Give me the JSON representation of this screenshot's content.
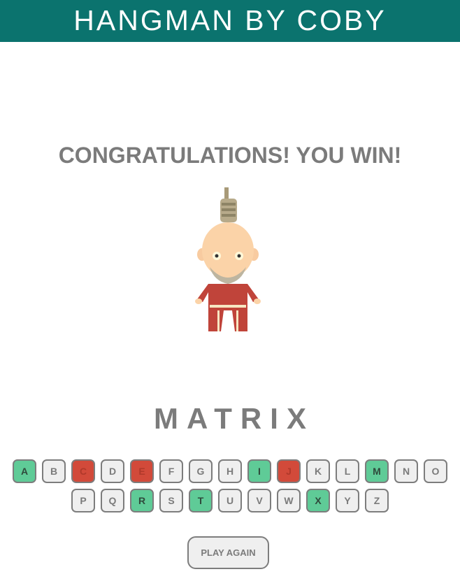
{
  "header": {
    "title": "HANGMAN BY COBY"
  },
  "game": {
    "status_message": "CONGRATULATIONS! YOU WIN!",
    "word_letters": [
      "M",
      "A",
      "T",
      "R",
      "I",
      "X"
    ],
    "wrong_guesses": 3
  },
  "keyboard": {
    "rows": [
      [
        {
          "letter": "A",
          "state": "correct"
        },
        {
          "letter": "B",
          "state": "unused"
        },
        {
          "letter": "C",
          "state": "wrong"
        },
        {
          "letter": "D",
          "state": "unused"
        },
        {
          "letter": "E",
          "state": "wrong"
        },
        {
          "letter": "F",
          "state": "unused"
        },
        {
          "letter": "G",
          "state": "unused"
        },
        {
          "letter": "H",
          "state": "unused"
        },
        {
          "letter": "I",
          "state": "correct"
        },
        {
          "letter": "J",
          "state": "wrong"
        },
        {
          "letter": "K",
          "state": "unused"
        },
        {
          "letter": "L",
          "state": "unused"
        },
        {
          "letter": "M",
          "state": "correct"
        },
        {
          "letter": "N",
          "state": "unused"
        },
        {
          "letter": "O",
          "state": "unused"
        }
      ],
      [
        {
          "letter": "P",
          "state": "unused"
        },
        {
          "letter": "Q",
          "state": "unused"
        },
        {
          "letter": "R",
          "state": "correct"
        },
        {
          "letter": "S",
          "state": "unused"
        },
        {
          "letter": "T",
          "state": "correct"
        },
        {
          "letter": "U",
          "state": "unused"
        },
        {
          "letter": "V",
          "state": "unused"
        },
        {
          "letter": "W",
          "state": "unused"
        },
        {
          "letter": "X",
          "state": "correct"
        },
        {
          "letter": "Y",
          "state": "unused"
        },
        {
          "letter": "Z",
          "state": "unused"
        }
      ]
    ]
  },
  "play_again": {
    "label": "PLAY AGAIN"
  },
  "colors": {
    "header_bg": "#0b736e",
    "correct_key": "#5fcb97",
    "wrong_key": "#d24a3a",
    "unused_key": "#efefef",
    "text_gray": "#7b7b7b"
  }
}
